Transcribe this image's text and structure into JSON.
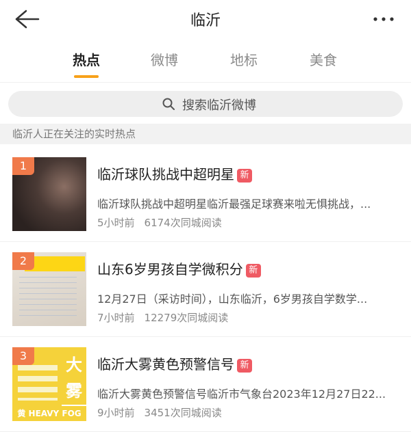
{
  "header": {
    "title": "临沂"
  },
  "tabs": [
    {
      "label": "热点"
    },
    {
      "label": "微博"
    },
    {
      "label": "地标"
    },
    {
      "label": "美食"
    }
  ],
  "search": {
    "placeholder": "搜索临沂微博"
  },
  "section": {
    "label": "临沂人正在关注的实时热点"
  },
  "colors": {
    "accent": "#f7a11a",
    "rank_bg": "#f07a4a",
    "new_badge": "#ef5a63"
  },
  "items": [
    {
      "rank": "1",
      "title": "临沂球队挑战中超明星",
      "badge": "新",
      "desc": "临沂球队挑战中超明星临沂最强足球赛来啦无惧挑战，...",
      "time": "5小时前",
      "reads": "6174次同城阅读"
    },
    {
      "rank": "2",
      "title": "山东6岁男孩自学微积分",
      "badge": "新",
      "desc": "12月27日（采访时间），山东临沂，6岁男孩自学数学...",
      "time": "7小时前",
      "reads": "12279次同城阅读"
    },
    {
      "rank": "3",
      "title": "临沂大雾黄色预警信号",
      "badge": "新",
      "desc": "临沂大雾黄色预警信号临沂市气象台2023年12月27日22...",
      "time": "9小时前",
      "reads": "3451次同城阅读",
      "thumb_text": {
        "char1": "大",
        "char2": "雾",
        "char3": "黄",
        "caption": "HEAVY FOG"
      }
    }
  ]
}
